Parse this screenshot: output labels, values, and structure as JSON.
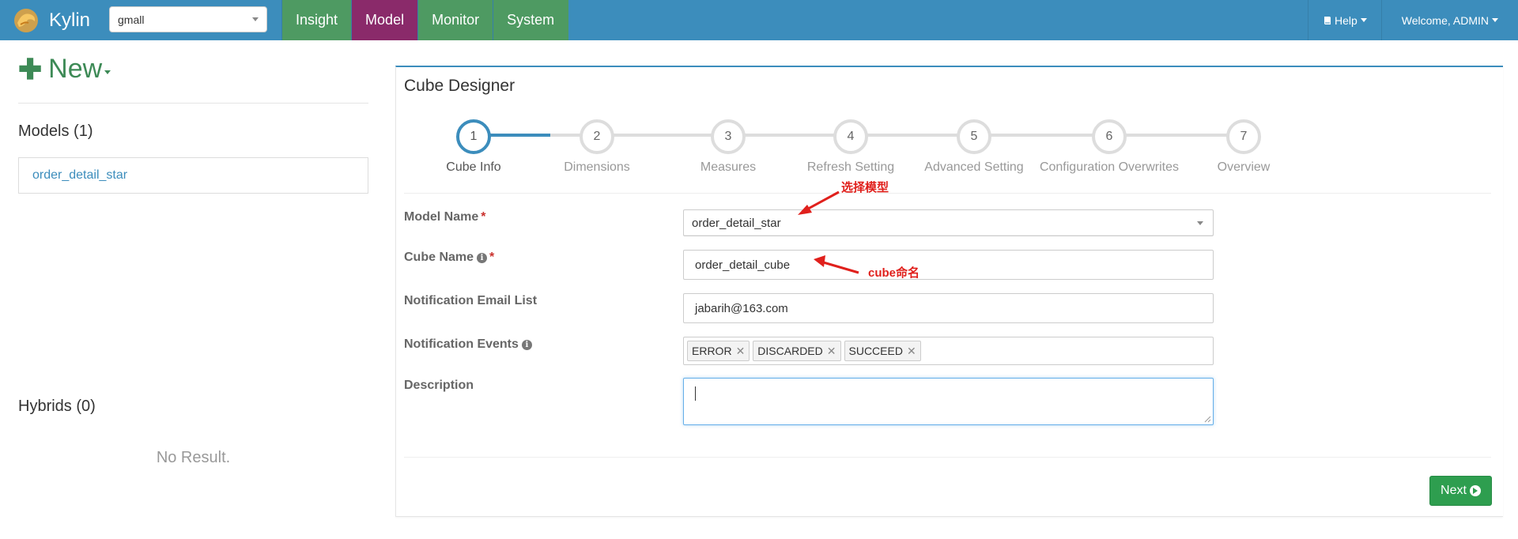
{
  "nav": {
    "brand": "Kylin",
    "project": "gmall",
    "tabs": [
      "Insight",
      "Model",
      "Monitor",
      "System"
    ],
    "help": "Help",
    "welcome": "Welcome, ADMIN"
  },
  "left": {
    "new_label": "New",
    "models_title": "Models (1)",
    "models": [
      "order_detail_star"
    ],
    "hybrids_title": "Hybrids (0)",
    "no_result": "No Result."
  },
  "designer": {
    "title": "Cube Designer",
    "progress_fraction": 0.1,
    "steps": [
      {
        "num": "1",
        "label": "Cube Info"
      },
      {
        "num": "2",
        "label": "Dimensions"
      },
      {
        "num": "3",
        "label": "Measures"
      },
      {
        "num": "4",
        "label": "Refresh Setting"
      },
      {
        "num": "5",
        "label": "Advanced Setting"
      },
      {
        "num": "6",
        "label": "Configuration Overwrites"
      },
      {
        "num": "7",
        "label": "Overview"
      }
    ],
    "active_step": 1,
    "form": {
      "model_name_label": "Model Name",
      "model_name_value": "order_detail_star",
      "cube_name_label": "Cube Name",
      "cube_name_value": "order_detail_cube",
      "email_label": "Notification Email List",
      "email_value": "jabarih@163.com",
      "events_label": "Notification Events",
      "events": [
        "ERROR",
        "DISCARDED",
        "SUCCEED"
      ],
      "description_label": "Description",
      "description_value": ""
    },
    "next_label": "Next",
    "annotations": {
      "select_model": "选择模型",
      "cube_name": "cube命名"
    }
  },
  "colors": {
    "navbar": "#3c8dbc",
    "insight": "#4e9a62",
    "model_tab": "#8a2a6a",
    "next": "#2e9e4f",
    "annotation": "#e0201c"
  }
}
